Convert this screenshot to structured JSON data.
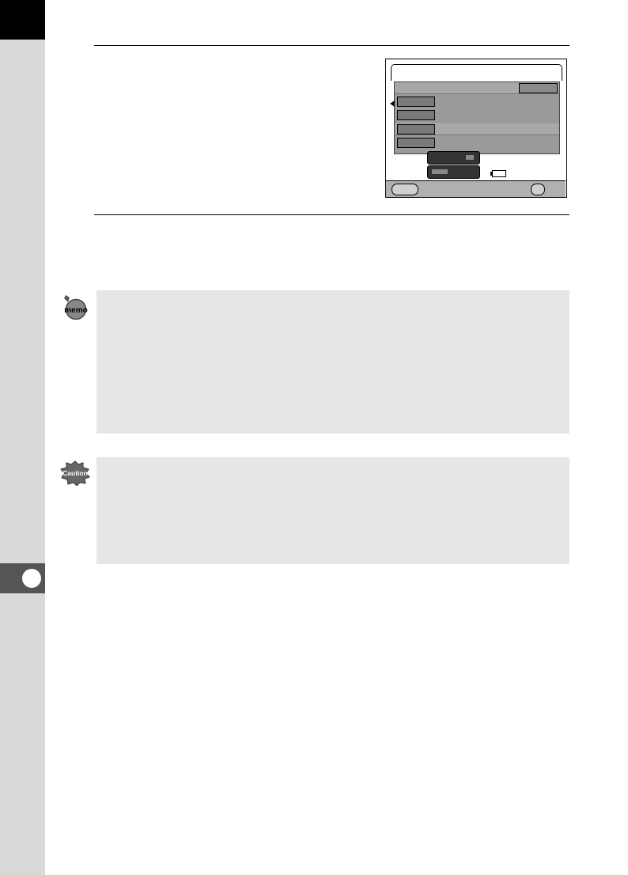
{
  "icons": {
    "memo": "memo-icon",
    "caution": "caution-icon"
  },
  "memo_icon_label": "memo",
  "caution_icon_label": "Caution"
}
